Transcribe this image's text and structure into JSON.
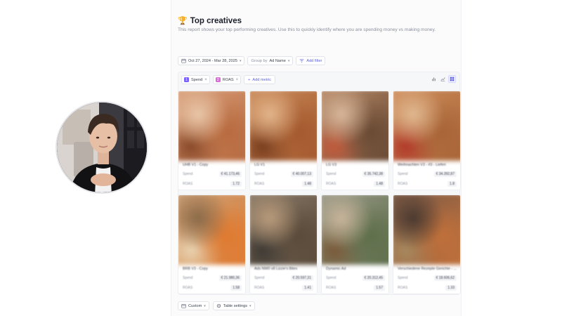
{
  "page": {
    "title": "Top creatives",
    "description": "This report shows your top performing creatives. Use this to quickly identify where you are spending money vs making money."
  },
  "filters": {
    "date_range": "Oct 27, 2024 - Mar 28, 2025",
    "group_by_label": "Group by",
    "group_by_value": "Ad Name",
    "add_filter": "Add filter"
  },
  "metrics": [
    {
      "index": "1",
      "label": "Spend",
      "color": "#7b61ff"
    },
    {
      "index": "2",
      "label": "ROAS",
      "color": "#d96fd6"
    }
  ],
  "add_metric": "Add metric",
  "cards": [
    {
      "name": "UHB V1 - Copy",
      "spend_label": "Spend",
      "spend": "€ 41.173,46",
      "roas_label": "ROAS",
      "roas": "1.72",
      "colors": [
        "#d9a07c",
        "#b86a3e",
        "#e8c6a8",
        "#8a4a2a"
      ]
    },
    {
      "name": "LG V1",
      "spend_label": "Spend",
      "spend": "€ 40.007,13",
      "roas_label": "ROAS",
      "roas": "1.48",
      "colors": [
        "#c98a5a",
        "#a55a2e",
        "#e2b48a",
        "#7a3f1f"
      ]
    },
    {
      "name": "LG V3",
      "spend_label": "Spend",
      "spend": "€ 35.742,38",
      "roas_label": "ROAS",
      "roas": "1.48",
      "colors": [
        "#b78a68",
        "#6a4a34",
        "#d8b69a",
        "#c05a3c"
      ]
    },
    {
      "name": "Weihnachten V3 - #3 - Lieferi",
      "spend_label": "Spend",
      "spend": "€ 34.392,87",
      "roas_label": "ROAS",
      "roas": "1.8",
      "colors": [
        "#cf8f5e",
        "#a86436",
        "#e0b890",
        "#b23a2a"
      ]
    },
    {
      "name": "BRB V3 - Copy",
      "spend_label": "Spend",
      "spend": "€ 21.980,36",
      "roas_label": "ROAS",
      "roas": "1.58",
      "colors": [
        "#c9a27a",
        "#e07a30",
        "#8a6a4a",
        "#e8d2b0"
      ]
    },
    {
      "name": "Ads NW0 v8 Lizzie's Bites",
      "spend_label": "Spend",
      "spend": "€ 20.597,31",
      "roas_label": "ROAS",
      "roas": "1.41",
      "colors": [
        "#8a7a68",
        "#5a4a3a",
        "#b89a7a",
        "#3e3a34"
      ]
    },
    {
      "name": "Dynamic Ad",
      "spend_label": "Spend",
      "spend": "€ 20.312,45",
      "roas_label": "ROAS",
      "roas": "1.57",
      "colors": [
        "#9a9a8a",
        "#5e6e4a",
        "#c8b49a",
        "#7a5a3a"
      ]
    },
    {
      "name": "Verschiedene Rezepte Gerichte - ...",
      "spend_label": "Spend",
      "spend": "€ 18.606,62",
      "roas_label": "ROAS",
      "roas": "1.33",
      "colors": [
        "#7a5a48",
        "#c0703a",
        "#4a3a30",
        "#a8885e"
      ]
    }
  ],
  "bottom": {
    "custom": "Custom",
    "table_settings": "Table settings"
  },
  "accent_color": "#5b5fe0"
}
